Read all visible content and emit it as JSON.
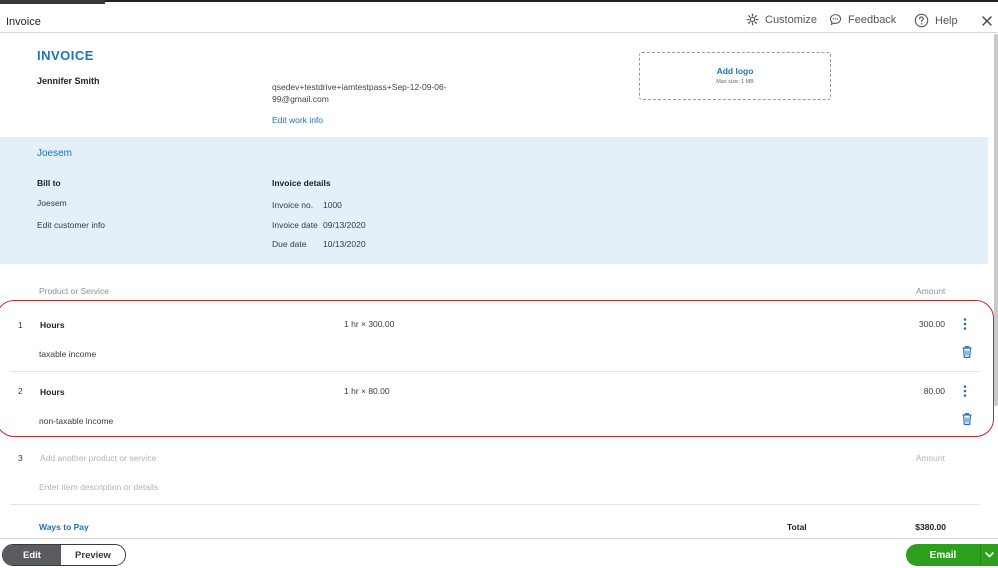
{
  "window": {
    "title": "Invoice"
  },
  "header": {
    "customize_label": "Customize",
    "feedback_label": "Feedback",
    "help_label": "Help"
  },
  "invoice": {
    "heading": "INVOICE",
    "company_name": "Jennifer Smith",
    "email_line1": "qsedev+testdrive+iamtestpass+Sep-12-09-06-",
    "email_line2": "99@gmail.com",
    "edit_work_info": "Edit work info",
    "logo_add": "Add logo",
    "logo_max": "Max size: 1 MB"
  },
  "customer": {
    "name": "Joesem",
    "bill_to_label": "Bill to",
    "bill_to_name": "Joesem",
    "edit_customer_info": "Edit customer info",
    "details_label": "Invoice details",
    "invoice_no_label": "Invoice no.",
    "invoice_no": "1000",
    "invoice_date_label": "Invoice date",
    "invoice_date": "09/13/2020",
    "due_date_label": "Due date",
    "due_date": "10/13/2020"
  },
  "lines": {
    "col_product": "Product or Service",
    "col_amount": "Amount",
    "items": [
      {
        "num": "1",
        "name": "Hours",
        "qty": "1 hr × 300.00",
        "amount": "300.00",
        "desc": "taxable income"
      },
      {
        "num": "2",
        "name": "Hours",
        "qty": "1 hr × 80.00",
        "amount": "80.00",
        "desc": "non-taxable income"
      }
    ],
    "new_num": "3",
    "new_placeholder": "Add another product or service",
    "new_amount_placeholder": "Amount",
    "new_desc_placeholder": "Enter item description or details"
  },
  "summary": {
    "ways_to_pay": "Ways to Pay",
    "total_label": "Total",
    "total_value": "$380.00"
  },
  "footer": {
    "edit_label": "Edit",
    "preview_label": "Preview",
    "email_label": "Email"
  },
  "colors": {
    "accent_blue": "#1f72b8",
    "customer_band": "#e3eff9",
    "email_green": "#2ca01c",
    "highlight_red": "#c6262e"
  }
}
